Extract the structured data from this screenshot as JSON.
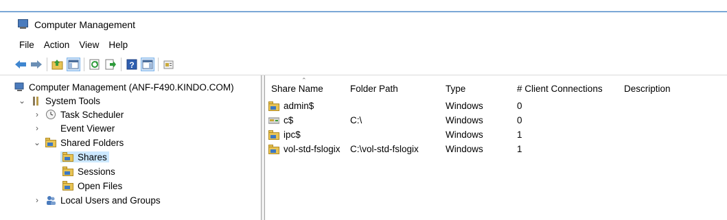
{
  "window": {
    "title": "Computer Management"
  },
  "menu": [
    "File",
    "Action",
    "View",
    "Help"
  ],
  "toolbar": {
    "icons": [
      "back-arrow-icon",
      "forward-arrow-icon",
      "up-folder-icon",
      "show-hide-console-tree-icon",
      "refresh-icon",
      "export-list-icon",
      "help-icon",
      "show-hide-action-pane-icon",
      "properties-icon"
    ]
  },
  "tree": {
    "root": "Computer Management (ANF-F490.KINDO.COM)",
    "system_tools": "System Tools",
    "task_scheduler": "Task Scheduler",
    "event_viewer": "Event Viewer",
    "shared_folders": "Shared Folders",
    "shares": "Shares",
    "sessions": "Sessions",
    "open_files": "Open Files",
    "local_users": "Local Users and Groups"
  },
  "table": {
    "columns": [
      "Share Name",
      "Folder Path",
      "Type",
      "# Client Connections",
      "Description"
    ],
    "rows": [
      {
        "name": "admin$",
        "path": "",
        "type": "Windows",
        "connections": "0",
        "description": ""
      },
      {
        "name": "c$",
        "path": "C:\\",
        "type": "Windows",
        "connections": "0",
        "description": ""
      },
      {
        "name": "ipc$",
        "path": "",
        "type": "Windows",
        "connections": "1",
        "description": ""
      },
      {
        "name": "vol-std-fslogix",
        "path": "C:\\vol-std-fslogix",
        "type": "Windows",
        "connections": "1",
        "description": ""
      }
    ]
  },
  "colors": {
    "selection": "#cce8ff",
    "folder": "#e8c455",
    "accent": "#4a7bbd"
  }
}
